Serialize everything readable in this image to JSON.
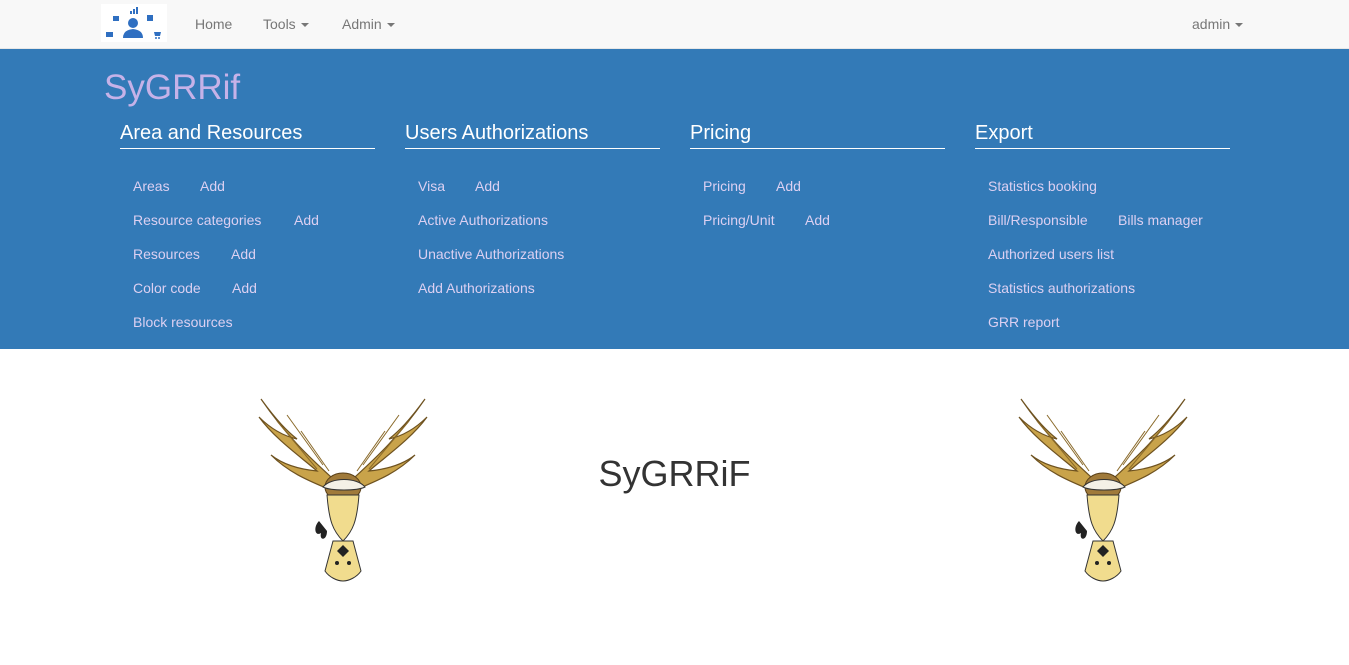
{
  "navbar": {
    "home": "Home",
    "tools": "Tools",
    "admin": "Admin",
    "user": "admin"
  },
  "panel": {
    "brand": "SyGRRif",
    "sections": [
      {
        "title": "Area and Resources",
        "rows": [
          [
            "Areas",
            "Add"
          ],
          [
            "Resource categories",
            "Add"
          ],
          [
            "Resources",
            "Add"
          ],
          [
            "Color code",
            "Add"
          ],
          [
            "Block resources"
          ]
        ]
      },
      {
        "title": "Users Authorizations",
        "rows": [
          [
            "Visa",
            "Add"
          ],
          [
            "Active Authorizations"
          ],
          [
            "Unactive Authorizations"
          ],
          [
            "Add Authorizations"
          ]
        ]
      },
      {
        "title": "Pricing",
        "rows": [
          [
            "Pricing",
            "Add"
          ],
          [
            "Pricing/Unit",
            "Add"
          ]
        ]
      },
      {
        "title": "Export",
        "rows": [
          [
            "Statistics booking"
          ],
          [
            "Bill/Responsible",
            "Bills manager"
          ],
          [
            "Authorized users list"
          ],
          [
            "Statistics authorizations"
          ],
          [
            "GRR report"
          ]
        ]
      }
    ]
  },
  "main": {
    "title": "SyGRRiF"
  },
  "colors": {
    "navbar_bg": "#f8f8f8",
    "panel_bg": "#337ab7",
    "brand": "#c6b2e8",
    "panel_link": "#dcd0f2"
  }
}
